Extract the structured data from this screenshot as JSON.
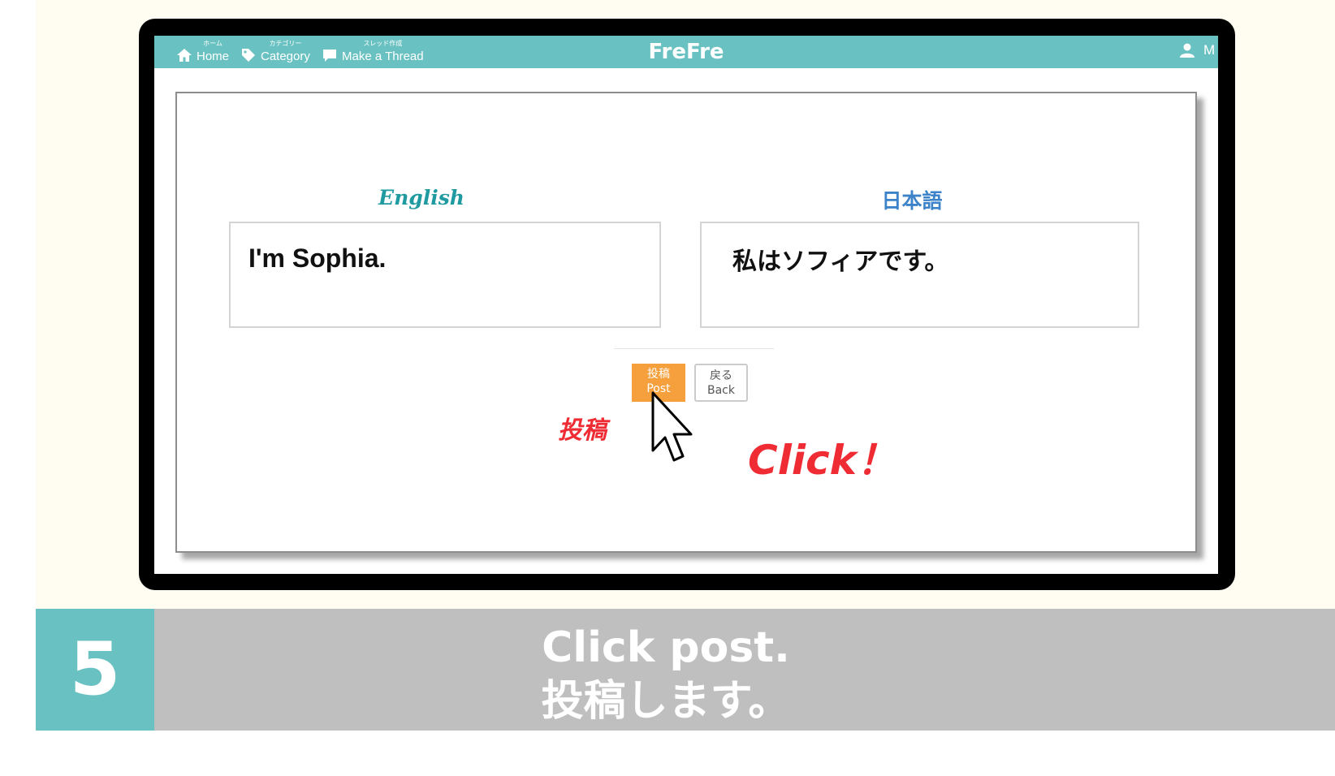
{
  "nav": {
    "items": [
      {
        "label": "Home",
        "sub": "ホーム",
        "icon": "home-icon"
      },
      {
        "label": "Category",
        "sub": "カテゴリー",
        "icon": "tag-icon"
      },
      {
        "label": "Make a Thread",
        "sub": "スレッド作成",
        "icon": "speech-bubble-icon"
      }
    ],
    "brand": "FreFre",
    "user_label": "M",
    "user_icon": "user-icon",
    "color": "#69c2c1"
  },
  "form": {
    "english_heading": "English",
    "japanese_heading": "日本語",
    "english_text": "I'm Sophia.",
    "japanese_text": "私はソフィアです。"
  },
  "buttons": {
    "post_ja": "投稿",
    "post_en": "Post",
    "back_ja": "戻る",
    "back_en": "Back",
    "post_color": "#f5a03c"
  },
  "annotation": {
    "label_ja": "投稿",
    "click": "Click！",
    "color": "#ef2c34",
    "cursor_icon": "mouse-pointer-icon"
  },
  "step": {
    "number": "5",
    "line1": "Click post.",
    "line2": "投稿します。"
  }
}
